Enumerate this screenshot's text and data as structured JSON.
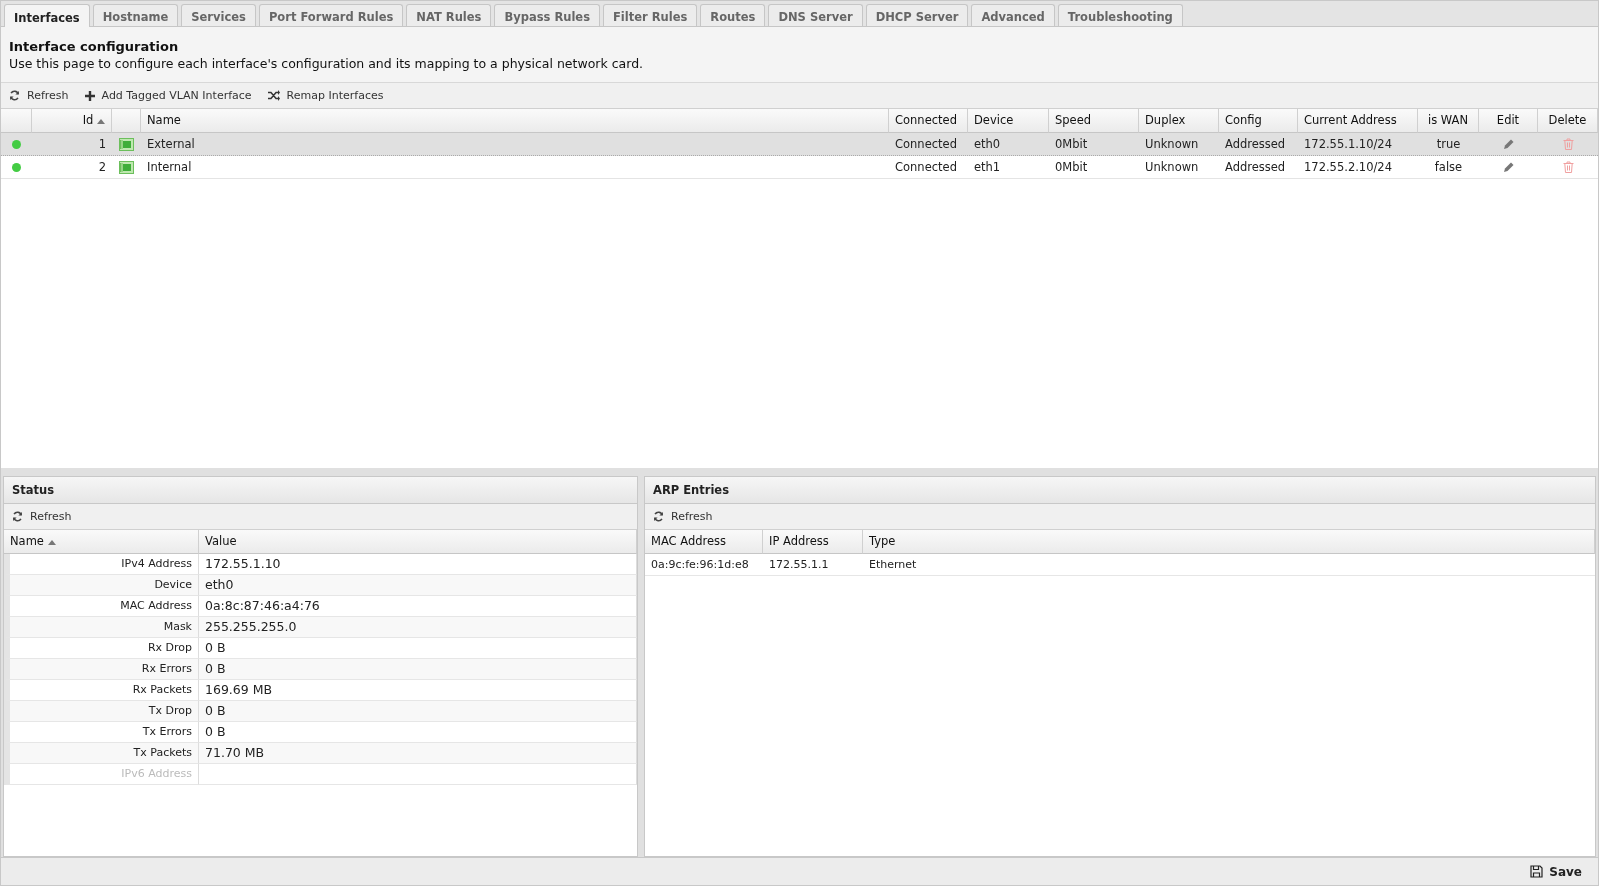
{
  "tabs": [
    {
      "label": "Interfaces",
      "selected": true
    },
    {
      "label": "Hostname",
      "selected": false
    },
    {
      "label": "Services",
      "selected": false
    },
    {
      "label": "Port Forward Rules",
      "selected": false
    },
    {
      "label": "NAT Rules",
      "selected": false
    },
    {
      "label": "Bypass Rules",
      "selected": false
    },
    {
      "label": "Filter Rules",
      "selected": false
    },
    {
      "label": "Routes",
      "selected": false
    },
    {
      "label": "DNS Server",
      "selected": false
    },
    {
      "label": "DHCP Server",
      "selected": false
    },
    {
      "label": "Advanced",
      "selected": false
    },
    {
      "label": "Troubleshooting",
      "selected": false
    }
  ],
  "header": {
    "title": "Interface configuration",
    "description": "Use this page to configure each interface's configuration and its mapping to a physical network card."
  },
  "toolbar": [
    {
      "kind": "refresh",
      "label": "Refresh"
    },
    {
      "kind": "add",
      "label": "Add Tagged VLAN Interface"
    },
    {
      "kind": "shuffle",
      "label": "Remap Interfaces"
    }
  ],
  "interfaces": {
    "columns": [
      "Id",
      "Name",
      "Connected",
      "Device",
      "Speed",
      "Duplex",
      "Config",
      "Current Address",
      "is WAN",
      "Edit",
      "Delete"
    ],
    "rows": [
      {
        "selected": true,
        "color": "#44cc44",
        "id": "1",
        "name": "External",
        "connected": "Connected",
        "device": "eth0",
        "speed": "0Mbit",
        "duplex": "Unknown",
        "config": "Addressed",
        "address": "172.55.1.10/24",
        "is_wan": "true"
      },
      {
        "selected": false,
        "color": "#44cc44",
        "id": "2",
        "name": "Internal",
        "connected": "Connected",
        "device": "eth1",
        "speed": "0Mbit",
        "duplex": "Unknown",
        "config": "Addressed",
        "address": "172.55.2.10/24",
        "is_wan": "false"
      }
    ]
  },
  "status": {
    "title": "Status",
    "refresh": "Refresh",
    "columns": [
      "Name",
      "Value"
    ],
    "rows": [
      {
        "name": "IPv4 Address",
        "value": "172.55.1.10",
        "disabled": false
      },
      {
        "name": "Device",
        "value": "eth0",
        "disabled": false
      },
      {
        "name": "MAC Address",
        "value": "0a:8c:87:46:a4:76",
        "disabled": false
      },
      {
        "name": "Mask",
        "value": "255.255.255.0",
        "disabled": false
      },
      {
        "name": "Rx Drop",
        "value": "0 B",
        "disabled": false
      },
      {
        "name": "Rx Errors",
        "value": "0 B",
        "disabled": false
      },
      {
        "name": "Rx Packets",
        "value": "169.69 MB",
        "disabled": false
      },
      {
        "name": "Tx Drop",
        "value": "0 B",
        "disabled": false
      },
      {
        "name": "Tx Errors",
        "value": "0 B",
        "disabled": false
      },
      {
        "name": "Tx Packets",
        "value": "71.70 MB",
        "disabled": false
      },
      {
        "name": "IPv6 Address",
        "disabled": true
      }
    ]
  },
  "arp": {
    "title": "ARP Entries",
    "refresh": "Refresh",
    "columns": [
      "MAC Address",
      "IP Address",
      "Type"
    ],
    "rows": [
      [
        "0a:9c:fe:96:1d:e8",
        "172.55.1.1",
        "Ethernet"
      ]
    ]
  },
  "footer": {
    "save": "Save"
  }
}
